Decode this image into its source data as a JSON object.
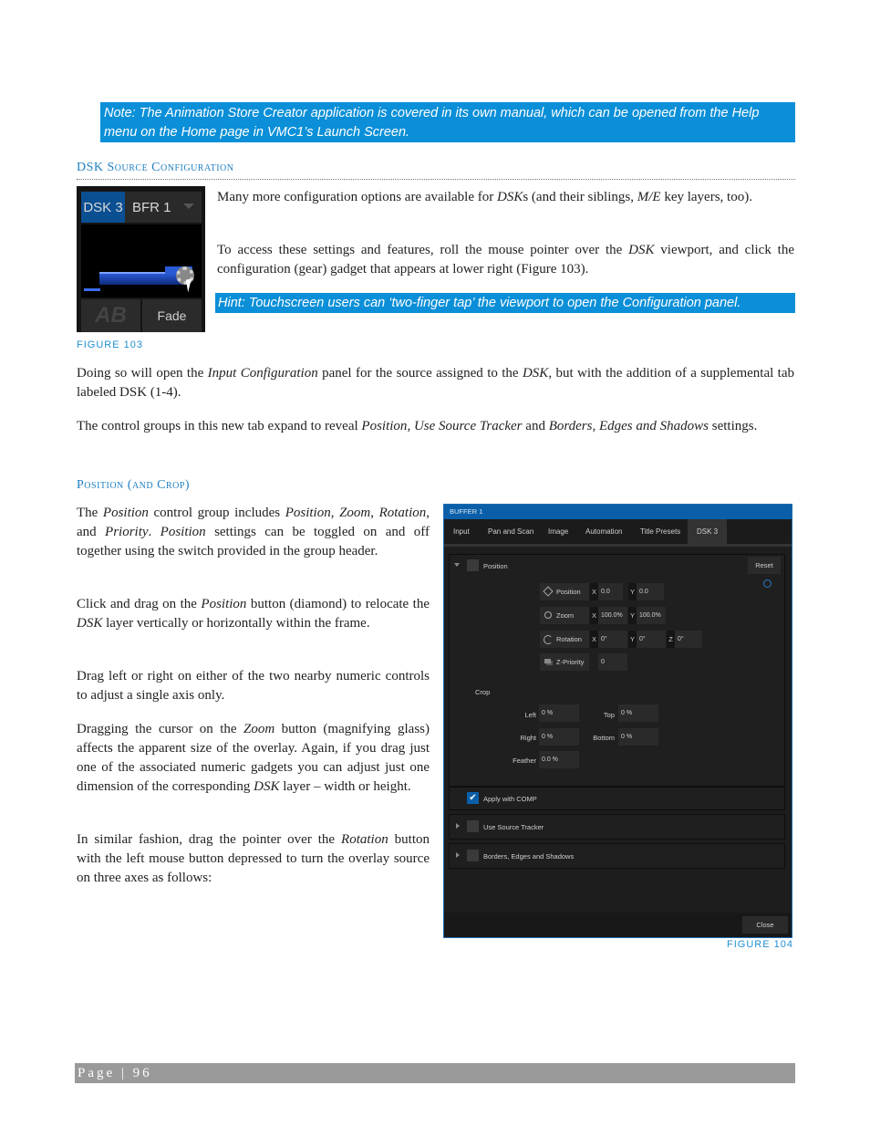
{
  "note_callout": "Note: The Animation Store Creator application is covered in its own manual, which can be opened from the Help menu on the Home page in VMC1’s Launch Screen.",
  "section_heading": "DSK Source Configuration",
  "figure103": {
    "tab_dsk": "DSK 3",
    "tab_buffer": "BFR 1",
    "button_ab": "AB",
    "button_fade": "Fade",
    "caption": "FIGURE 103"
  },
  "para1": {
    "a": "Many more configuration options are available for ",
    "b": "DSK",
    "c": "s (and their siblings, ",
    "d": "M/E",
    "e": " key layers, too)."
  },
  "para2": {
    "a": "To access these settings and features, roll the mouse pointer over the ",
    "b": "DSK",
    "c": " viewport, and click the configuration (gear) gadget that appears at lower right (Figure 103)."
  },
  "hint_callout": "Hint: Touchscreen users can ‘two-finger tap’ the viewport to open the Configuration panel.",
  "para3": {
    "a": "Doing so will open the ",
    "b": "Input Configuration",
    "c": " panel for the source assigned to the ",
    "d": "DSK",
    "e": ", but with the addition of a supplemental tab labeled DSK (1-4)."
  },
  "para4": {
    "a": "The control groups in this new tab expand to reveal ",
    "b": "Position",
    "c": ", ",
    "d": "Use Source Tracker",
    "e": " and ",
    "f": "Borders, Edges and Shadows",
    "g": " settings."
  },
  "subheading": "Position (and Crop)",
  "para5": {
    "a": "The ",
    "b": "Position",
    "c": " control group includes ",
    "d": "Position",
    "e": ", ",
    "f": "Zoom,",
    "g": " ",
    "h": "Rotation",
    "i": ", and ",
    "j": "Priority",
    "k": ". ",
    "l": "Position",
    "m": " settings can be toggled on and off together using the switch provided in the group header."
  },
  "para6": {
    "a": "Click and drag on the ",
    "b": "Position",
    "c": " button (diamond) to relocate the ",
    "d": "DSK",
    "e": " layer vertically or horizontally within the frame."
  },
  "para7": "Drag left or right on either of the two nearby numeric controls to adjust a single axis only.",
  "para8": {
    "a": "Dragging the cursor on the ",
    "b": "Zoom",
    "c": " button (magnifying glass) affects the apparent size of the overlay. Again, if you drag just one of the associated numeric gadgets you can adjust just one dimension of the corresponding ",
    "d": "DSK",
    "e": " layer – width or height."
  },
  "para9": {
    "a": "In similar fashion, drag the pointer over the ",
    "b": "Rotation",
    "c": " button with the left mouse button depressed to turn the overlay source on three axes as follows:"
  },
  "figure104": {
    "title": "BUFFER 1",
    "tabs": [
      "Input",
      "Pan and Scan",
      "Image",
      "Automation",
      "Title Presets",
      "DSK 3"
    ],
    "active_tab": "DSK 3",
    "position_group": {
      "label": "Position",
      "reset": "Reset",
      "rows": [
        {
          "button": "Position",
          "x": "0.0",
          "y": "0.0"
        },
        {
          "button": "Zoom",
          "x": "100.0%",
          "y": "100.0%"
        },
        {
          "button": "Rotation",
          "x": "0°",
          "y": "0°",
          "z": "0°"
        },
        {
          "button": "Z-Priority",
          "value": "0"
        }
      ],
      "axis_x": "X",
      "axis_y": "Y",
      "axis_z": "Z"
    },
    "crop": {
      "label": "Crop",
      "left_label": "Left",
      "left": "0 %",
      "top_label": "Top",
      "top": "0 %",
      "right_label": "Right",
      "right": "0 %",
      "bottom_label": "Bottom",
      "bottom": "0 %",
      "feather_label": "Feather",
      "feather": "0.0 %"
    },
    "apply_comp": {
      "label": "Apply with COMP",
      "checked": true
    },
    "source_tracker": "Use Source Tracker",
    "borders": "Borders, Edges and Shadows",
    "close": "Close",
    "caption": "FIGURE 104"
  },
  "footer": "Page | 96"
}
